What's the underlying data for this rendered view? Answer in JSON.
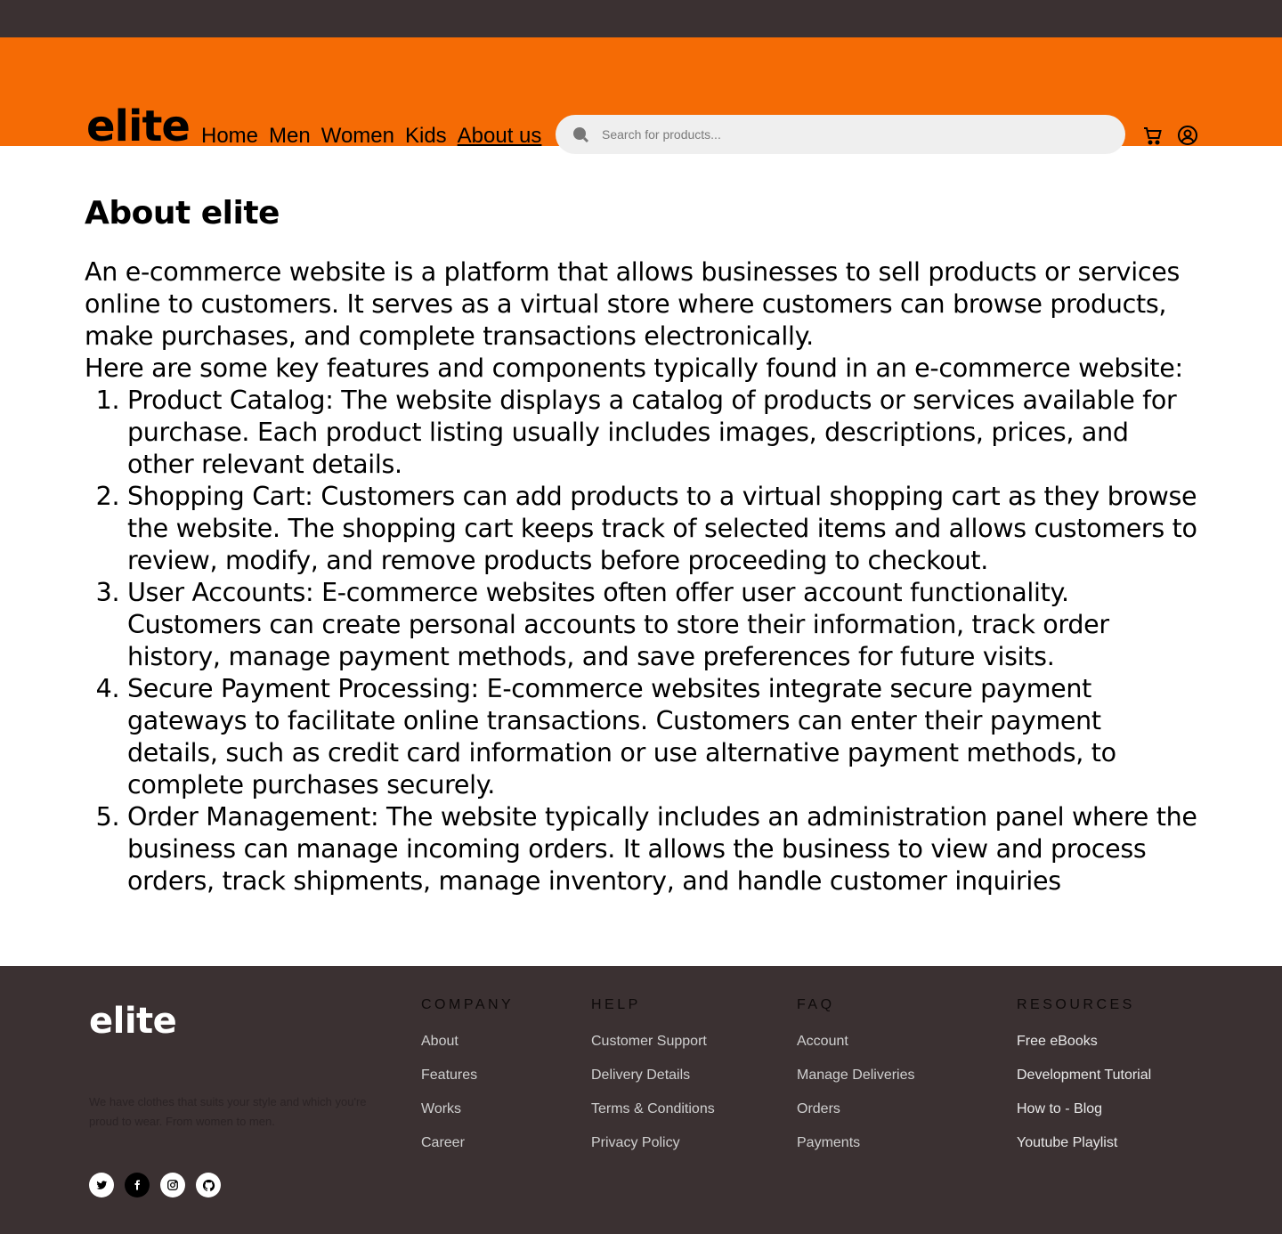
{
  "brand": "elite",
  "nav": [
    "Home",
    "Men",
    "Women",
    "Kids",
    "About us"
  ],
  "search": {
    "placeholder": "Search for products..."
  },
  "colors": {
    "header": "#f56b05",
    "dark": "#3b3132"
  },
  "page": {
    "title": "About elite",
    "intro": "An e-commerce website is a platform that allows businesses to sell products or services online to customers. It serves as a virtual store where customers can browse products, make purchases, and complete transactions electronically.",
    "lead": "Here are some key features and components typically found in an e-commerce website:",
    "items": [
      "Product Catalog: The website displays a catalog of products or services available for purchase. Each product listing usually includes images, descriptions, prices, and other relevant details.",
      "Shopping Cart: Customers can add products to a virtual shopping cart as they browse the website. The shopping cart keeps track of selected items and allows customers to review, modify, and remove products before proceeding to checkout.",
      "User Accounts: E-commerce websites often offer user account functionality. Customers can create personal accounts to store their information, track order history, manage payment methods, and save preferences for future visits.",
      "Secure Payment Processing: E-commerce websites integrate secure payment gateways to facilitate online transactions. Customers can enter their payment details, such as credit card information or use alternative payment methods, to complete purchases securely.",
      "Order Management: The website typically includes an administration panel where the business can manage incoming orders. It allows the business to view and process orders, track shipments, manage inventory, and handle customer inquiries"
    ]
  },
  "footer": {
    "logo": "elite",
    "tagline": "We have clothes that suits your style and which you're proud to wear. From women to men.",
    "columns": [
      {
        "title": "COMPANY",
        "links": [
          "About",
          "Features",
          "Works",
          "Career"
        ]
      },
      {
        "title": "HELP",
        "links": [
          "Customer Support",
          "Delivery Details",
          "Terms & Conditions",
          "Privacy Policy"
        ]
      },
      {
        "title": "FAQ",
        "links": [
          "Account",
          "Manage Deliveries",
          "Orders",
          "Payments"
        ]
      },
      {
        "title": "RESOURCES",
        "links": [
          "Free eBooks",
          "Development Tutorial",
          "How to - Blog",
          "Youtube Playlist"
        ]
      }
    ],
    "social": [
      "twitter-icon",
      "facebook-icon",
      "instagram-icon",
      "github-icon"
    ]
  }
}
